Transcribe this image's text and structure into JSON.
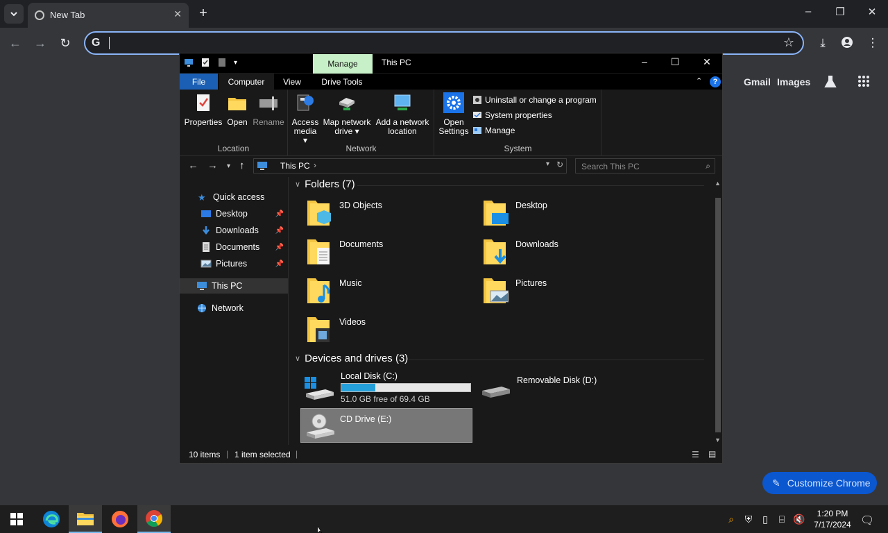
{
  "browser": {
    "tab_title": "New Tab",
    "ntp_links": [
      "Gmail",
      "Images"
    ],
    "customize_label": "Customize Chrome",
    "omnibox_icon": "G"
  },
  "explorer": {
    "title": "This PC",
    "manage_tab": "Manage",
    "ribbon_tabs": [
      "File",
      "Computer",
      "View",
      "Drive Tools"
    ],
    "ribbon": {
      "location": {
        "label": "Location",
        "buttons": [
          "Properties",
          "Open",
          "Rename"
        ]
      },
      "network": {
        "label": "Network",
        "access_media": [
          "Access",
          "media"
        ],
        "map_drive": [
          "Map network",
          "drive"
        ],
        "add_location": [
          "Add a network",
          "location"
        ]
      },
      "system": {
        "label": "System",
        "open_settings": [
          "Open",
          "Settings"
        ],
        "uninstall": "Uninstall or change a program",
        "system_properties": "System properties",
        "manage": "Manage"
      }
    },
    "address": "This PC",
    "search_placeholder": "Search This PC",
    "nav": {
      "quick_access": "Quick access",
      "desktop": "Desktop",
      "downloads": "Downloads",
      "documents": "Documents",
      "pictures": "Pictures",
      "this_pc": "This PC",
      "network": "Network"
    },
    "folders_header": "Folders (7)",
    "folders": [
      "3D Objects",
      "Desktop",
      "Documents",
      "Downloads",
      "Music",
      "Pictures",
      "Videos"
    ],
    "drives_header": "Devices and drives (3)",
    "drives": {
      "c_name": "Local Disk (C:)",
      "c_free": "51.0 GB free of 69.4 GB",
      "c_used_fraction": 0.265,
      "d_name": "Removable Disk (D:)",
      "e_name": "CD Drive (E:)"
    },
    "status": {
      "items": "10 items",
      "selected": "1 item selected"
    }
  },
  "taskbar": {
    "time": "1:20 PM",
    "date": "7/17/2024"
  },
  "colors": {
    "accent_blue": "#0b57d0",
    "file_tab": "#1a5fb4",
    "manage_tab": "#c8f0c8",
    "usage_fill": "#26a0da"
  }
}
